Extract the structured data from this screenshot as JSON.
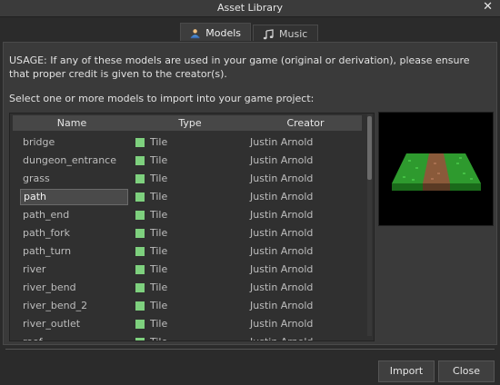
{
  "window": {
    "title": "Asset Library",
    "close_glyph": "✕"
  },
  "tabs": [
    {
      "label": "Models",
      "icon": "person-icon",
      "active": true
    },
    {
      "label": "Music",
      "icon": "music-note-icon",
      "active": false
    }
  ],
  "usage_text": "USAGE: If any of these models are used in your game (original or derivation), please ensure that proper credit is given to the creator(s).",
  "select_label": "Select one or more models to import into your game project:",
  "table": {
    "columns": [
      "Name",
      "Type",
      "Creator"
    ],
    "rows": [
      {
        "name": "bridge",
        "type": "Tile",
        "creator": "Justin Arnold"
      },
      {
        "name": "dungeon_entrance",
        "type": "Tile",
        "creator": "Justin Arnold"
      },
      {
        "name": "grass",
        "type": "Tile",
        "creator": "Justin Arnold"
      },
      {
        "name": "path",
        "type": "Tile",
        "creator": "Justin Arnold"
      },
      {
        "name": "path_end",
        "type": "Tile",
        "creator": "Justin Arnold"
      },
      {
        "name": "path_fork",
        "type": "Tile",
        "creator": "Justin Arnold"
      },
      {
        "name": "path_turn",
        "type": "Tile",
        "creator": "Justin Arnold"
      },
      {
        "name": "river",
        "type": "Tile",
        "creator": "Justin Arnold"
      },
      {
        "name": "river_bend",
        "type": "Tile",
        "creator": "Justin Arnold"
      },
      {
        "name": "river_bend_2",
        "type": "Tile",
        "creator": "Justin Arnold"
      },
      {
        "name": "river_outlet",
        "type": "Tile",
        "creator": "Justin Arnold"
      },
      {
        "name": "roof",
        "type": "Tile",
        "creator": "Justin Arnold"
      }
    ],
    "selected_row": "path",
    "type_color": "#7ed07e"
  },
  "buttons": {
    "import": "Import",
    "close": "Close"
  }
}
